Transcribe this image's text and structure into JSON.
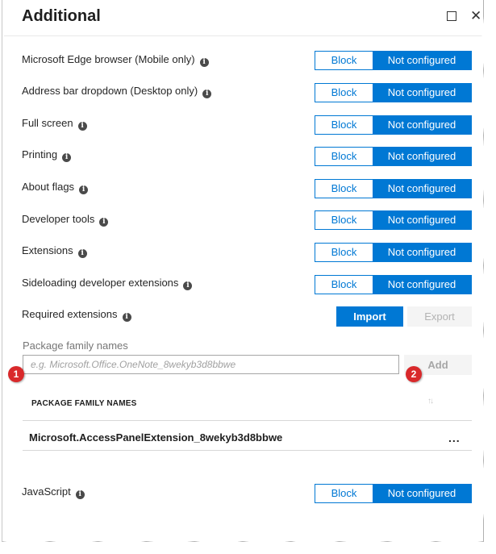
{
  "header": {
    "title": "Additional",
    "maximize_icon": "square-outline-icon",
    "close_icon": "close-x-icon",
    "close_glyph": "✕"
  },
  "info_glyph": "i",
  "settings": [
    {
      "label": "Microsoft Edge browser (Mobile only)",
      "off_option": "Block",
      "on_option": "Not configured",
      "selected": "Not configured"
    },
    {
      "label": "Address bar dropdown (Desktop only)",
      "off_option": "Block",
      "on_option": "Not configured",
      "selected": "Not configured"
    },
    {
      "label": "Full screen",
      "off_option": "Block",
      "on_option": "Not configured",
      "selected": "Not configured"
    },
    {
      "label": "Printing",
      "off_option": "Block",
      "on_option": "Not configured",
      "selected": "Not configured"
    },
    {
      "label": "About flags",
      "off_option": "Block",
      "on_option": "Not configured",
      "selected": "Not configured"
    },
    {
      "label": "Developer tools",
      "off_option": "Block",
      "on_option": "Not configured",
      "selected": "Not configured"
    },
    {
      "label": "Extensions",
      "off_option": "Block",
      "on_option": "Not configured",
      "selected": "Not configured"
    },
    {
      "label": "Sideloading developer extensions",
      "off_option": "Block",
      "on_option": "Not configured",
      "selected": "Not configured"
    }
  ],
  "required_extensions": {
    "label": "Required extensions",
    "import_label": "Import",
    "export_label": "Export"
  },
  "package_input": {
    "label": "Package family names",
    "placeholder": "e.g. Microsoft.Office.OneNote_8wekyb3d8bbwe",
    "value": "",
    "add_label": "Add"
  },
  "callouts": [
    "1",
    "2"
  ],
  "table": {
    "column_header": "PACKAGE FAMILY NAMES",
    "sort_glyph": "↑↓",
    "rows": [
      {
        "value": "Microsoft.AccessPanelExtension_8wekyb3d8bbwe",
        "menu_glyph": "..."
      }
    ]
  },
  "javascript": {
    "label": "JavaScript",
    "off_option": "Block",
    "on_option": "Not configured",
    "selected": "Not configured"
  },
  "colors": {
    "accent": "#0078d4",
    "callout": "#d9292b",
    "disabled_bg": "#f4f4f4"
  }
}
